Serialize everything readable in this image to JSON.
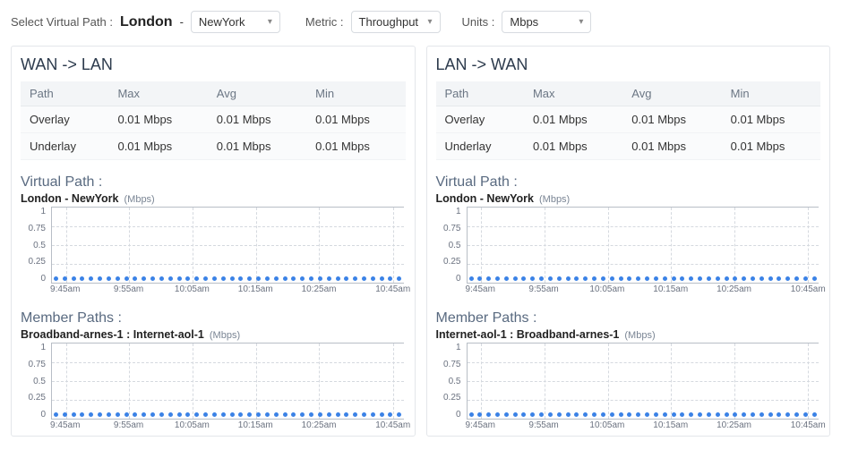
{
  "topbar": {
    "select_label": "Select Virtual Path :",
    "path_from": "London",
    "path_sep": "-",
    "path_to": "NewYork",
    "metric_label": "Metric :",
    "metric_value": "Throughput",
    "units_label": "Units :",
    "units_value": "Mbps"
  },
  "headers": {
    "path": "Path",
    "max": "Max",
    "avg": "Avg",
    "min": "Min"
  },
  "labels": {
    "virtual_path": "Virtual Path :",
    "member_paths": "Member Paths :",
    "unit_mbps": "(Mbps)"
  },
  "panels": [
    {
      "title": "WAN -> LAN",
      "rows": [
        {
          "path": "Overlay",
          "max": "0.01 Mbps",
          "avg": "0.01 Mbps",
          "min": "0.01 Mbps"
        },
        {
          "path": "Underlay",
          "max": "0.01 Mbps",
          "avg": "0.01 Mbps",
          "min": "0.01 Mbps"
        }
      ],
      "virtual_path_name": "London - NewYork",
      "member_path_name": "Broadband-arnes-1 : Internet-aol-1"
    },
    {
      "title": "LAN -> WAN",
      "rows": [
        {
          "path": "Overlay",
          "max": "0.01 Mbps",
          "avg": "0.01 Mbps",
          "min": "0.01 Mbps"
        },
        {
          "path": "Underlay",
          "max": "0.01 Mbps",
          "avg": "0.01 Mbps",
          "min": "0.01 Mbps"
        }
      ],
      "virtual_path_name": "London - NewYork",
      "member_path_name": "Internet-aol-1 : Broadband-arnes-1"
    }
  ],
  "chart_data": {
    "type": "line",
    "ylabel": "",
    "xlabel": "",
    "ylim": [
      0,
      1
    ],
    "y_ticks": [
      "1",
      "0.75",
      "0.5",
      "0.25",
      "0"
    ],
    "x_ticks": [
      "9:45am",
      "9:55am",
      "10:05am",
      "10:15am",
      "10:25am",
      "10:45am"
    ],
    "series": [
      {
        "name": "London - NewYork (WAN->LAN)",
        "values": [
          0.01,
          0.01,
          0.01,
          0.01,
          0.01,
          0.01,
          0.01,
          0.01,
          0.01,
          0.01,
          0.01,
          0.01,
          0.01,
          0.01,
          0.01,
          0.01,
          0.01,
          0.01,
          0.01,
          0.01,
          0.01,
          0.01,
          0.01,
          0.01,
          0.01,
          0.01,
          0.01,
          0.01,
          0.01,
          0.01,
          0.01,
          0.01,
          0.01,
          0.01,
          0.01,
          0.01,
          0.01,
          0.01,
          0.01,
          0.01
        ]
      },
      {
        "name": "Broadband-arnes-1 : Internet-aol-1 (WAN->LAN)",
        "values": [
          0.01,
          0.01,
          0.01,
          0.01,
          0.01,
          0.01,
          0.01,
          0.01,
          0.01,
          0.01,
          0.01,
          0.01,
          0.01,
          0.01,
          0.01,
          0.01,
          0.01,
          0.01,
          0.01,
          0.01,
          0.01,
          0.01,
          0.01,
          0.01,
          0.01,
          0.01,
          0.01,
          0.01,
          0.01,
          0.01,
          0.01,
          0.01,
          0.01,
          0.01,
          0.01,
          0.01,
          0.01,
          0.01,
          0.01,
          0.01
        ]
      },
      {
        "name": "London - NewYork (LAN->WAN)",
        "values": [
          0.01,
          0.01,
          0.01,
          0.01,
          0.01,
          0.01,
          0.01,
          0.01,
          0.01,
          0.01,
          0.01,
          0.01,
          0.01,
          0.01,
          0.01,
          0.01,
          0.01,
          0.01,
          0.01,
          0.01,
          0.01,
          0.01,
          0.01,
          0.01,
          0.01,
          0.01,
          0.01,
          0.01,
          0.01,
          0.01,
          0.01,
          0.01,
          0.01,
          0.01,
          0.01,
          0.01,
          0.01,
          0.01,
          0.01,
          0.01
        ]
      },
      {
        "name": "Internet-aol-1 : Broadband-arnes-1 (LAN->WAN)",
        "values": [
          0.01,
          0.01,
          0.01,
          0.01,
          0.01,
          0.01,
          0.01,
          0.01,
          0.01,
          0.01,
          0.01,
          0.01,
          0.01,
          0.01,
          0.01,
          0.01,
          0.01,
          0.01,
          0.01,
          0.01,
          0.01,
          0.01,
          0.01,
          0.01,
          0.01,
          0.01,
          0.01,
          0.01,
          0.01,
          0.01,
          0.01,
          0.01,
          0.01,
          0.01,
          0.01,
          0.01,
          0.01,
          0.01,
          0.01,
          0.01
        ]
      }
    ]
  }
}
